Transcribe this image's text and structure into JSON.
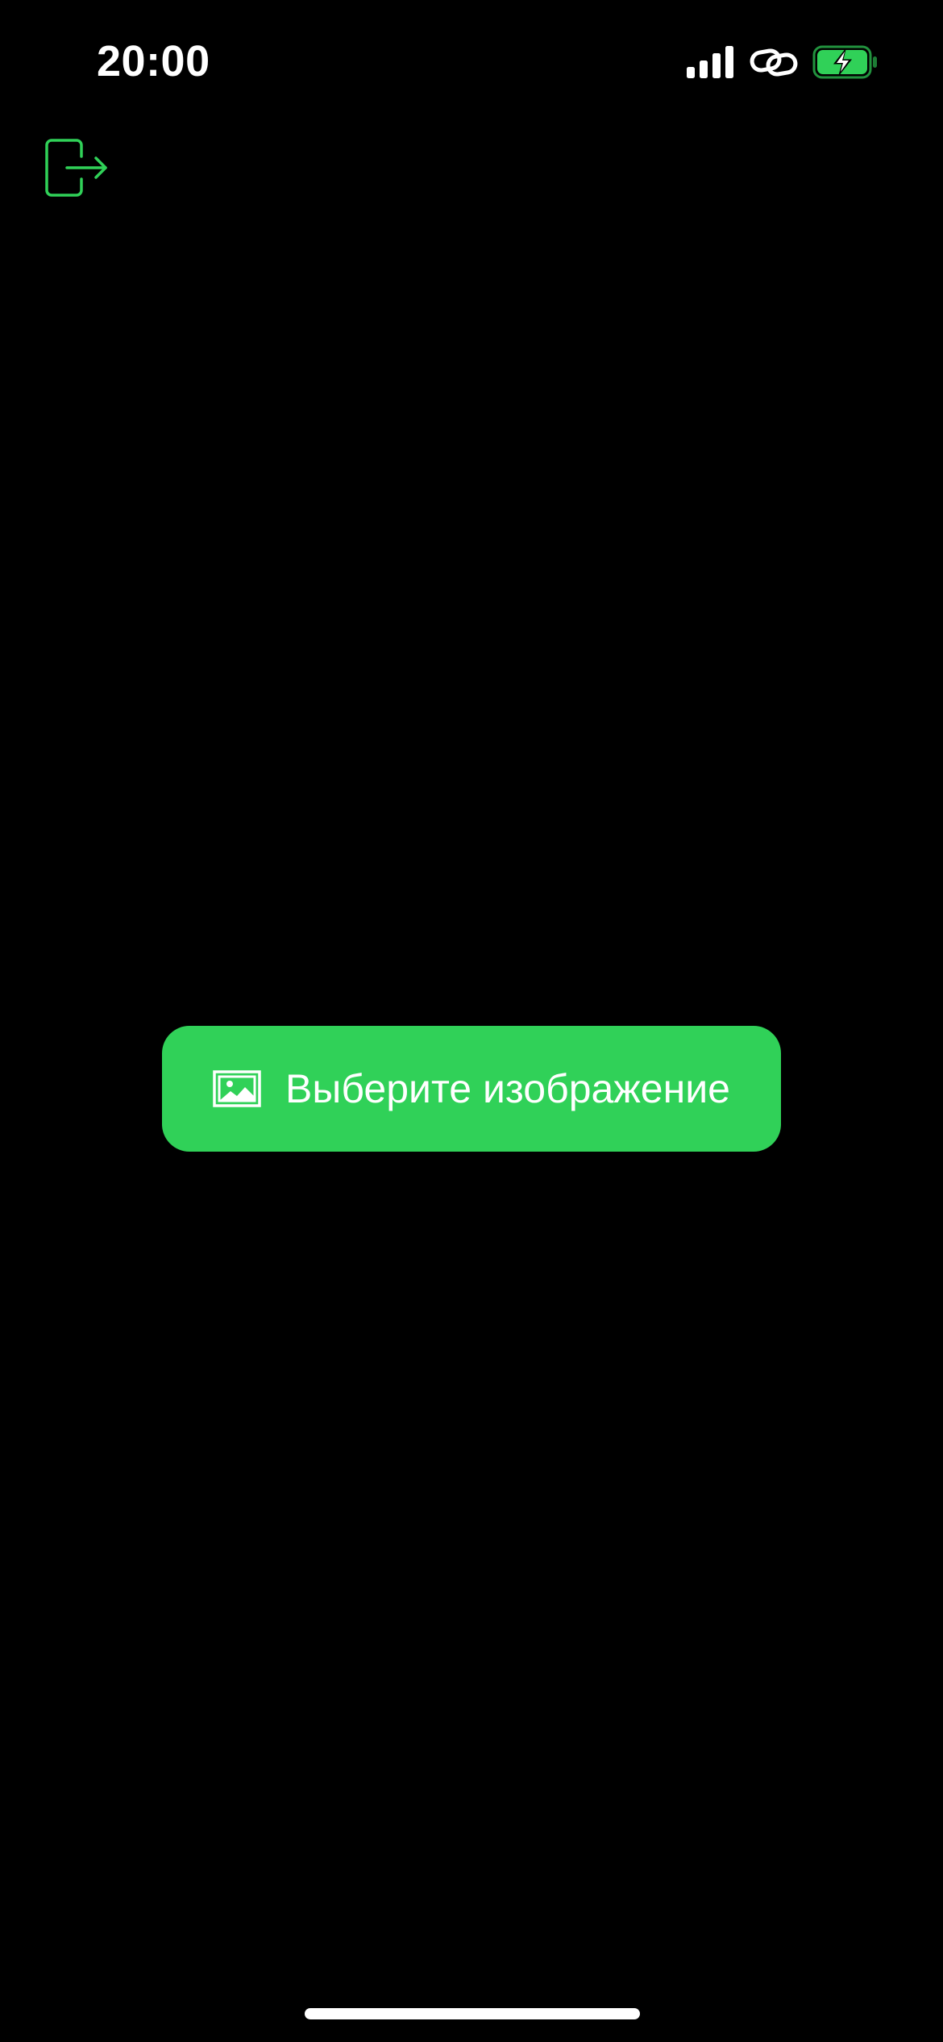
{
  "status_bar": {
    "time": "20:00",
    "icons": [
      "signal-icon",
      "link-icon",
      "battery-charging-icon"
    ]
  },
  "toolbar": {
    "logout_icon": "logout-icon"
  },
  "main": {
    "select_image_button": {
      "label": "Выберите изображение",
      "icon": "photo-icon"
    }
  },
  "colors": {
    "background": "#000000",
    "accent": "#30d158",
    "text": "#ffffff"
  }
}
